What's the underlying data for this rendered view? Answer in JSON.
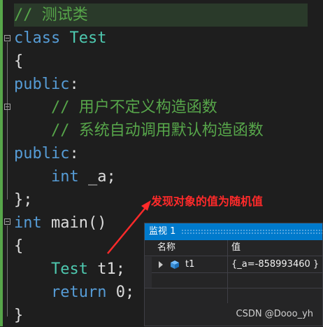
{
  "code_lines": [
    "// 测试类",
    "class Test",
    "{",
    "public:",
    "    // 用户不定义构造函数",
    "    // 系统自动调用默认构造函数",
    "public:",
    "    int _a;",
    "};",
    "int main()",
    "{",
    "    Test t1;",
    "    return 0;",
    "}"
  ],
  "annotation": "发现对象的值为随机值",
  "watch": {
    "title": "监视 1",
    "col_name": "名称",
    "col_value": "值",
    "rows": [
      {
        "name": "t1",
        "value": "{_a=-858993460 }"
      }
    ]
  },
  "watermark": "CSDN @Dooo_yh",
  "colors": {
    "background": "#1e1e1e",
    "keyword": "#569cd6",
    "type": "#4ec9b0",
    "comment": "#57a64a",
    "annotation": "#ff2a2a",
    "watch_title_bar": "#007acc"
  },
  "icons": [
    "fold-icon",
    "expand-arrow-icon",
    "object-cube-icon"
  ]
}
